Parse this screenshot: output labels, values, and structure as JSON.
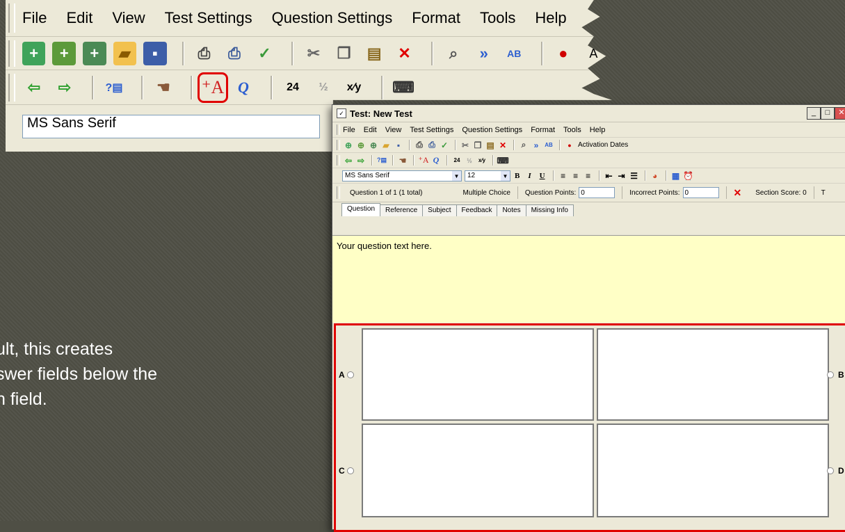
{
  "zoom": {
    "menu": [
      {
        "label": "File",
        "u": "F"
      },
      {
        "label": "Edit",
        "u": "E"
      },
      {
        "label": "View",
        "u": "V"
      },
      {
        "label": "Test Settings",
        "u": "T"
      },
      {
        "label": "Question Settings",
        "u": "Q"
      },
      {
        "label": "Format",
        "u": "o"
      },
      {
        "label": "Tools",
        "u": "l"
      },
      {
        "label": "Help",
        "u": "H"
      }
    ],
    "toolbar1_trailing": "A",
    "font_name": "MS Sans Serif"
  },
  "caption": "ult, this creates\nswer fields below the\nn field.",
  "window": {
    "title": "Test: New Test",
    "menu": [
      "File",
      "Edit",
      "View",
      "Test Settings",
      "Question Settings",
      "Format",
      "Tools",
      "Help"
    ],
    "activation_label": "Activation Dates",
    "font_combo": "MS Sans Serif",
    "size_combo": "12",
    "status": {
      "question_of": "Question 1 of 1 (1 total)",
      "question_type": "Multiple Choice",
      "points_label": "Question Points:",
      "points_value": "0",
      "incorrect_label": "Incorrect Points:",
      "incorrect_value": "0",
      "section_score": "Section Score: 0",
      "trailing": "T"
    },
    "tabs": [
      "Question",
      "Reference",
      "Subject",
      "Feedback",
      "Notes",
      "Missing Info"
    ],
    "question_text": "Your question text here.",
    "answers": [
      "A",
      "B",
      "C",
      "D"
    ]
  },
  "colors": {
    "highlight": "#e00000",
    "question_bg": "#ffffc6",
    "slide_bg": "#4f4f45"
  }
}
